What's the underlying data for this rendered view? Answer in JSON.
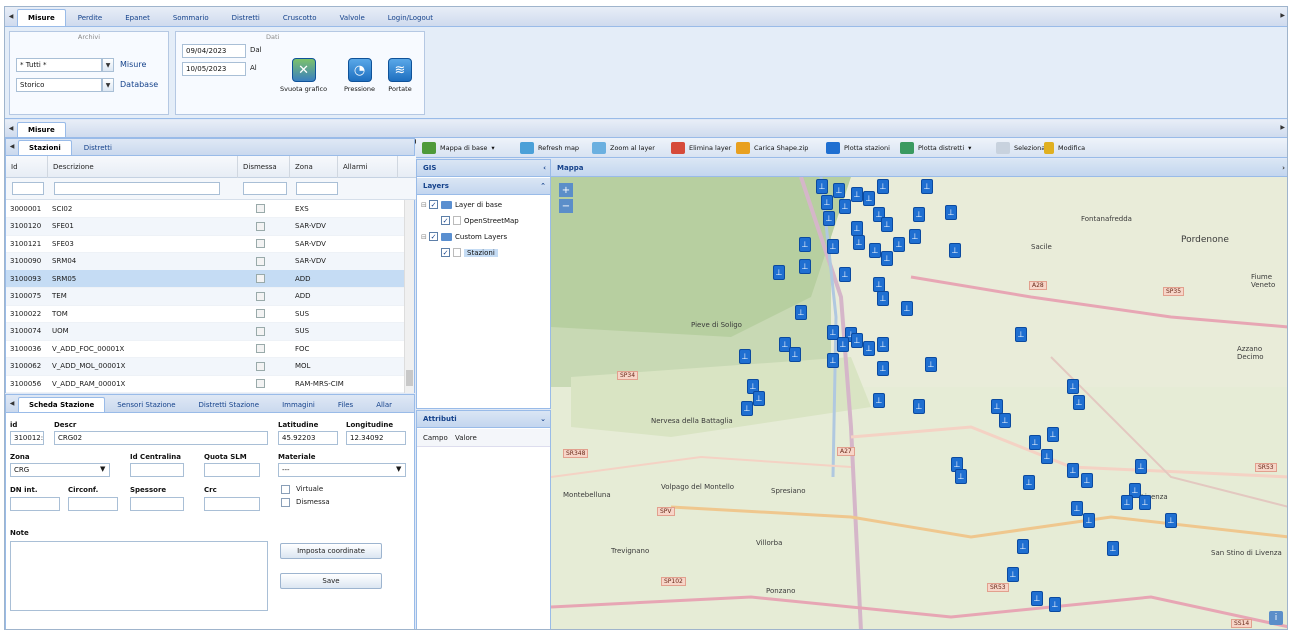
{
  "top_tabs": [
    "Misure",
    "Perdite",
    "Epanet",
    "Sommario",
    "Distretti",
    "Cruscotto",
    "Valvole",
    "Login/Logout"
  ],
  "archivi": {
    "title": "Archivi",
    "filter_value": "* Tutti *",
    "misure_label": "Misure",
    "source_value": "Storico",
    "database_label": "Database"
  },
  "dati": {
    "title": "Dati",
    "date_from": "09/04/2023",
    "date_from_label": "Dal",
    "date_to": "10/05/2023",
    "date_to_label": "Al",
    "buttons": [
      "Svuota grafico",
      "Pressione",
      "Portate"
    ]
  },
  "misure_tab": "Misure",
  "left_tabs": [
    "Stazioni",
    "Distretti"
  ],
  "grid": {
    "columns": [
      "Id",
      "Descrizione",
      "Dismessa",
      "Zona",
      "Allarmi"
    ],
    "rows": [
      {
        "id": "3000001",
        "desc": "SCI02",
        "zona": "EXS"
      },
      {
        "id": "3100120",
        "desc": "SFE01",
        "zona": "SAR-VDV"
      },
      {
        "id": "3100121",
        "desc": "SFE03",
        "zona": "SAR-VDV"
      },
      {
        "id": "3100090",
        "desc": "SRM04",
        "zona": "SAR-VDV"
      },
      {
        "id": "3100093",
        "desc": "SRM05",
        "zona": "ADD"
      },
      {
        "id": "3100075",
        "desc": "TEM",
        "zona": "ADD"
      },
      {
        "id": "3100022",
        "desc": "TOM",
        "zona": "SUS"
      },
      {
        "id": "3100074",
        "desc": "UOM",
        "zona": "SUS"
      },
      {
        "id": "3100036",
        "desc": "V_ADD_FOC_00001X",
        "zona": "FOC"
      },
      {
        "id": "3100062",
        "desc": "V_ADD_MOL_00001X",
        "zona": "MOL"
      },
      {
        "id": "3100056",
        "desc": "V_ADD_RAM_00001X",
        "zona": "RAM-MRS-CIM"
      }
    ]
  },
  "detail_tabs": [
    "Scheda Stazione",
    "Sensori Stazione",
    "Distretti Stazione",
    "Immagini",
    "Files",
    "Allar"
  ],
  "detail": {
    "id_label": "id",
    "id_value": "310012:",
    "descr_label": "Descr",
    "descr_value": "CRG02",
    "lat_label": "Latitudine",
    "lat_value": "45.92203",
    "lon_label": "Longitudine",
    "lon_value": "12.34092",
    "zona_label": "Zona",
    "zona_value": "CRG",
    "centralina_label": "Id Centralina",
    "quota_label": "Quota SLM",
    "materiale_label": "Materiale",
    "materiale_value": "---",
    "dn_label": "DN int.",
    "circ_label": "Circonf.",
    "spessore_label": "Spessore",
    "crc_label": "Crc",
    "virtuale_label": "Virtuale",
    "dismessa_label": "Dismessa",
    "note_label": "Note",
    "imposta_label": "Imposta coordinate",
    "save_label": "Save"
  },
  "map_toolbar": [
    "Mappa di base",
    "Refresh map",
    "Zoom al layer",
    "Elimina layer",
    "Carica Shape.zip",
    "Plotta stazioni",
    "Plotta distretti",
    "Seleziona",
    "Modifica"
  ],
  "gis": {
    "title": "GIS",
    "layers_title": "Layers",
    "base_layer": "Layer di base",
    "osm": "OpenStreetMap",
    "custom_layers": "Custom Layers",
    "stazioni": "Stazioni",
    "attributi_title": "Attributi",
    "campo": "Campo",
    "valore": "Valore"
  },
  "mappa_title": "Mappa",
  "map_labels": [
    "Fontanafredda",
    "Sacile",
    "Pordenone",
    "Fiume Veneto",
    "Pieve di Soligo",
    "Azzano Decimo",
    "Nervesa della Battaglia",
    "Volpago del Montello",
    "Montebelluna",
    "Spresiano",
    "Villorba",
    "Trevignano",
    "Ponzano",
    "San Stino di Livenza",
    "Livenza"
  ],
  "road_shields": [
    "A28",
    "SP35",
    "SP34",
    "SR348",
    "A27",
    "SR53",
    "SPV",
    "SP102",
    "SR53",
    "SS14"
  ],
  "colors": {
    "accent": "#15428b",
    "pin": "#1f6fd1",
    "panel_border": "#99bbe8"
  }
}
